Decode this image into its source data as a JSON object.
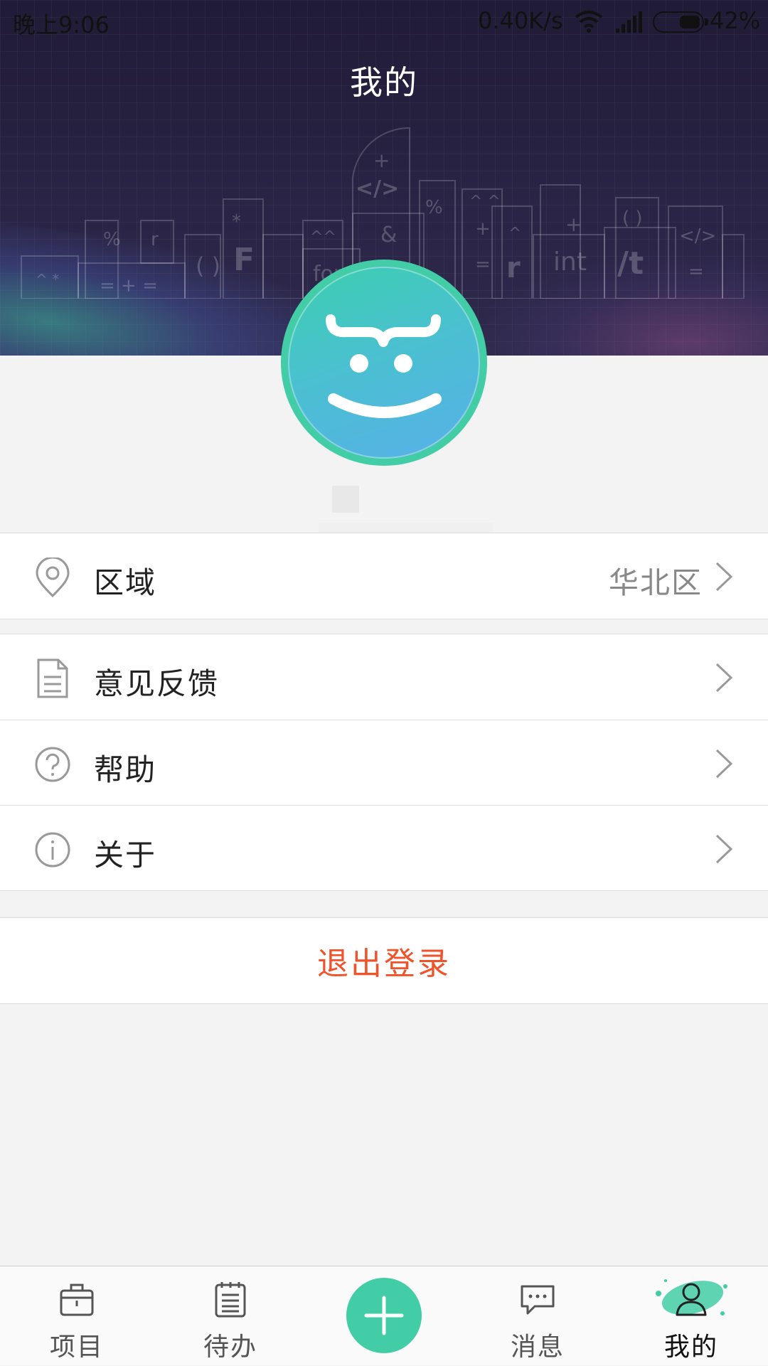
{
  "status_bar": {
    "time": "晚上9:06",
    "network_speed": "0.40K/s",
    "battery_percent": "42%",
    "battery_level": 0.42
  },
  "header": {
    "title": "我的"
  },
  "menu": {
    "region": {
      "label": "区域",
      "value": "华北区",
      "icon": "location-pin-icon"
    },
    "feedback": {
      "label": "意见反馈",
      "icon": "document-icon"
    },
    "help": {
      "label": "帮助",
      "icon": "question-circle-icon"
    },
    "about": {
      "label": "关于",
      "icon": "info-circle-icon"
    }
  },
  "logout_label": "退出登录",
  "tabbar": {
    "items": [
      {
        "label": "项目",
        "icon": "briefcase-icon"
      },
      {
        "label": "待办",
        "icon": "notepad-icon"
      },
      {
        "label": "",
        "icon": "plus-icon"
      },
      {
        "label": "消息",
        "icon": "chat-bubble-icon"
      },
      {
        "label": "我的",
        "icon": "person-icon",
        "active": true
      }
    ]
  },
  "colors": {
    "accent": "#42cda6",
    "logout": "#f0522a",
    "header_bg": "#231e3b"
  }
}
